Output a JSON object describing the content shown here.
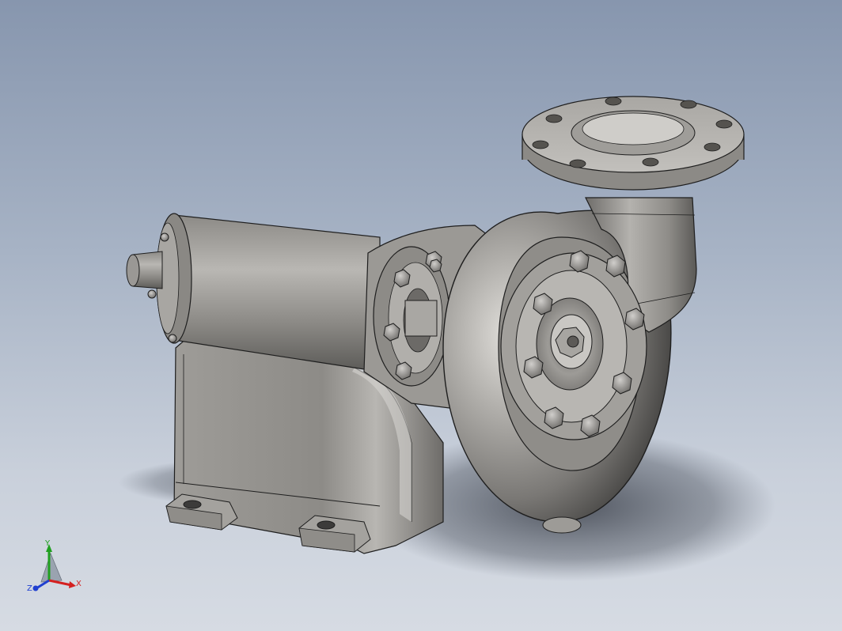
{
  "viewport": {
    "model": "centrifugal-pump-assembly"
  },
  "triad": {
    "x_label": "X",
    "y_label": "Y",
    "z_label": "Z",
    "x_color": "#d42020",
    "y_color": "#20a020",
    "z_color": "#2040d0"
  },
  "colors": {
    "background_top": "#8796ae",
    "background_bottom": "#d6dbe3",
    "metal_light": "#c8c6c3",
    "metal_mid": "#9a9895",
    "metal_dark": "#4e4d4b",
    "edge": "#1e1e1e"
  }
}
